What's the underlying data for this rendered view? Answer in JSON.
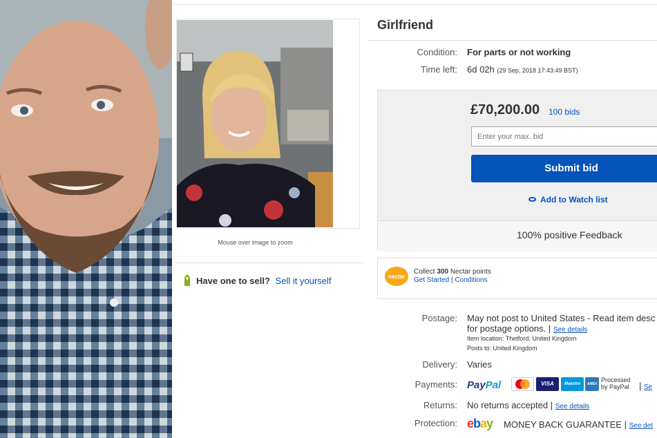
{
  "listing": {
    "title": "Girlfriend",
    "zoom_hint": "Mouse over image to zoom",
    "sell_prompt": "Have one to sell?",
    "sell_link": "Sell it yourself"
  },
  "details": {
    "condition_label": "Condition:",
    "condition_value": "For parts or not working",
    "time_left_label": "Time left:",
    "time_left_value": "6d 02h",
    "time_left_date": "(29 Sep, 2018   17:43:49 BST)"
  },
  "bid": {
    "price": "£70,200.00",
    "bids": "100 bids",
    "input_placeholder": "Enter your max. bid",
    "submit_label": "Submit bid",
    "watch_label": "Add to Watch list",
    "feedback": "100% positive Feedback"
  },
  "nectar": {
    "logo_text": "nectar",
    "collect_prefix": "Collect",
    "points": "300",
    "collect_suffix": "Nectar points",
    "get_started": "Get Started",
    "separator": "|",
    "conditions": "Conditions"
  },
  "shipping": {
    "postage_label": "Postage:",
    "postage_value": "May not post to United States - Read item desc",
    "postage_value2": "for postage options. |",
    "see_details": "See details",
    "item_location": "Item location:  Thetford, United Kingdom",
    "posts_to": "Posts to:  United Kingdom",
    "delivery_label": "Delivery:",
    "delivery_value": "Varies",
    "payments_label": "Payments:",
    "paypal_a": "Pay",
    "paypal_b": "Pal",
    "card_visa": "VISA",
    "card_maestro": "Maestro",
    "card_amex": "AMEX",
    "processed_line1": "Processed",
    "processed_line2": "by PayPal",
    "payments_sep": "|",
    "payments_link": "Se",
    "returns_label": "Returns:",
    "returns_value": "No returns accepted |",
    "returns_link": "See details",
    "protection_label": "Protection:",
    "ebay_e": "e",
    "ebay_b": "b",
    "ebay_a": "a",
    "ebay_y": "y",
    "mbg": "MONEY BACK GUARANTEE",
    "mbg_sep": "|",
    "mbg_link": "See det"
  },
  "colors": {
    "link": "#0654ba",
    "submit": "#0654ba",
    "panel": "#f0f0f0"
  }
}
